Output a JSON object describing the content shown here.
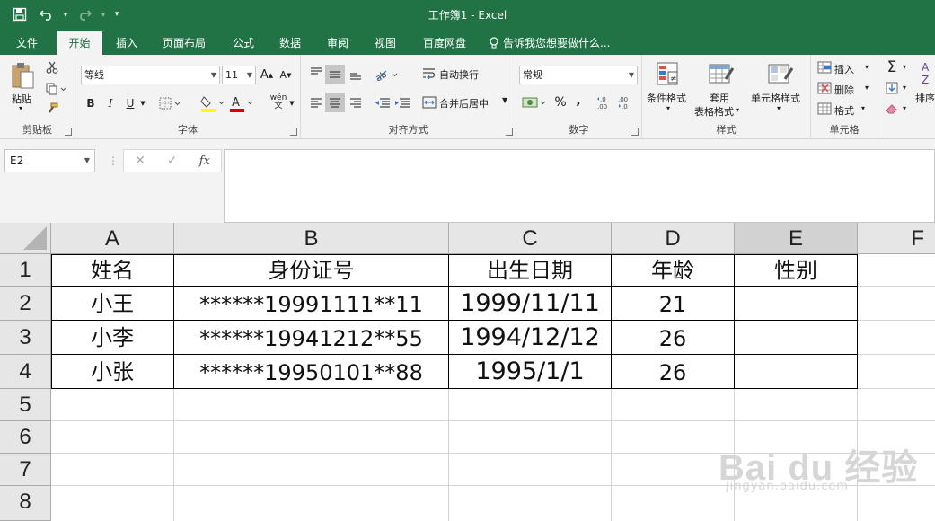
{
  "titlebar": {
    "title": "工作簿1 - Excel"
  },
  "tabs": [
    {
      "label": "文件"
    },
    {
      "label": "开始"
    },
    {
      "label": "插入"
    },
    {
      "label": "页面布局"
    },
    {
      "label": "公式"
    },
    {
      "label": "数据"
    },
    {
      "label": "审阅"
    },
    {
      "label": "视图"
    },
    {
      "label": "百度网盘"
    }
  ],
  "tell_me": "告诉我您想要做什么...",
  "ribbon": {
    "clipboard": {
      "paste_label": "粘贴",
      "group_label": "剪贴板"
    },
    "font": {
      "font_name": "等线",
      "font_size": "11",
      "group_label": "字体",
      "bold": "B",
      "italic": "I",
      "underline": "U",
      "increase": "A",
      "decrease": "A",
      "phonetic": "wén"
    },
    "alignment": {
      "wrap_text": "自动换行",
      "merge_center": "合并后居中",
      "group_label": "对齐方式"
    },
    "number": {
      "format": "常规",
      "percent": "%",
      "comma": ",",
      "group_label": "数字"
    },
    "styles": {
      "conditional": "条件格式",
      "table_format_1": "套用",
      "table_format_2": "表格格式",
      "cell_styles": "单元格样式",
      "group_label": "样式"
    },
    "cells": {
      "insert": "插入",
      "delete": "删除",
      "format": "格式",
      "group_label": "单元格"
    },
    "editing": {
      "sort_label": "排序"
    }
  },
  "formula_bar": {
    "name_box": "E2",
    "cancel": "✕",
    "enter": "✓",
    "fx": "fx",
    "content": ""
  },
  "grid": {
    "columns": [
      "A",
      "B",
      "C",
      "D",
      "E",
      "F"
    ],
    "rows": [
      "1",
      "2",
      "3",
      "4",
      "5",
      "6",
      "7",
      "8"
    ],
    "header_row": [
      "姓名",
      "身份证号",
      "出生日期",
      "年龄",
      "性别"
    ],
    "data": [
      [
        "小王",
        "******19991111**11",
        "1999/11/11",
        "21",
        ""
      ],
      [
        "小李",
        "******19941212**55",
        "1994/12/12",
        "26",
        ""
      ],
      [
        "小张",
        "******19950101**88",
        "1995/1/1",
        "26",
        ""
      ]
    ]
  },
  "watermark": {
    "text": "Bai du 经验",
    "url": "jingyan.baidu.com"
  },
  "colors": {
    "brand_green": "#217346",
    "ribbon_bg": "#f3f3f3"
  }
}
